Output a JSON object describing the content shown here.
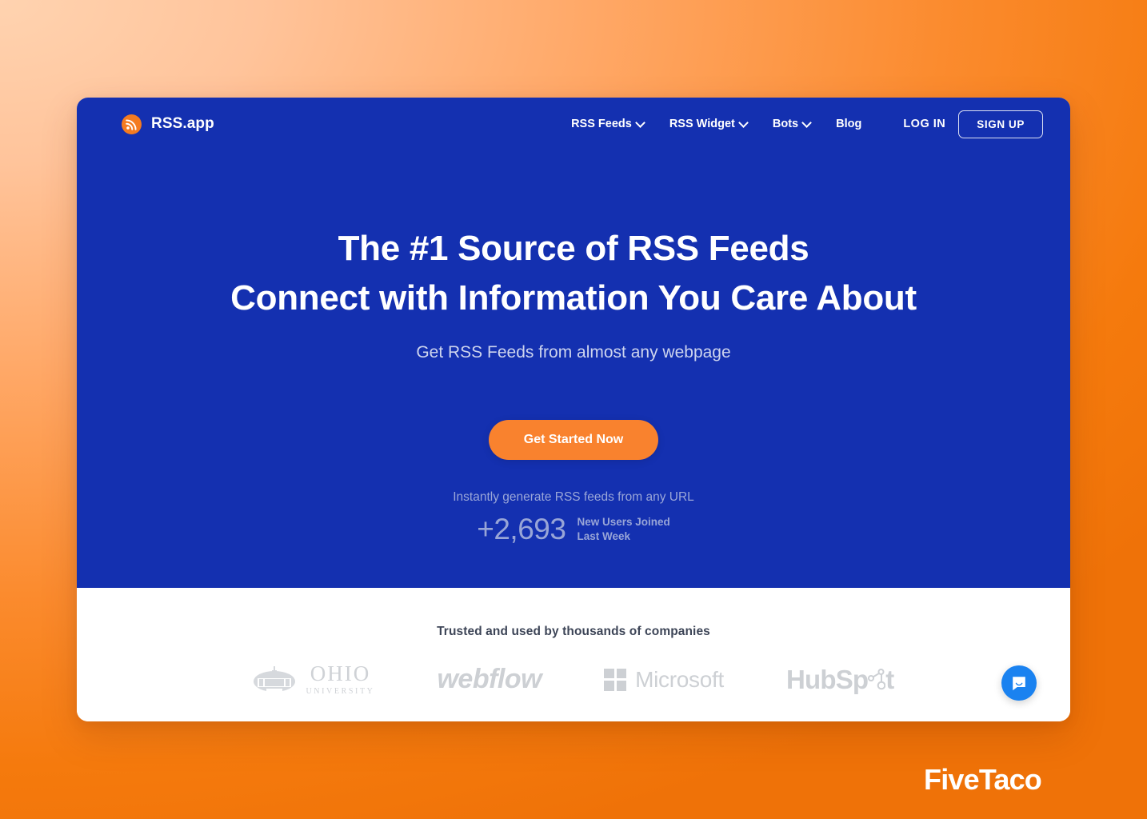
{
  "brand": {
    "name": "RSS.app",
    "logo_icon": "rss-icon",
    "logo_color": "#f47b20"
  },
  "nav": {
    "items": [
      {
        "label": "RSS Feeds",
        "has_dropdown": true
      },
      {
        "label": "RSS Widget",
        "has_dropdown": true
      },
      {
        "label": "Bots",
        "has_dropdown": true
      },
      {
        "label": "Blog",
        "has_dropdown": false
      }
    ],
    "login_label": "LOG IN",
    "signup_label": "SIGN UP"
  },
  "hero": {
    "headline_line1": "The #1 Source of RSS Feeds",
    "headline_line2": "Connect with Information You Care About",
    "subhead": "Get RSS Feeds from almost any webpage",
    "cta_label": "Get Started Now",
    "tagline": "Instantly generate RSS feeds from any URL",
    "stats_number": "+2,693",
    "stats_label_line1": "New Users Joined",
    "stats_label_line2": "Last Week",
    "background_color": "#1430b0",
    "cta_color": "#f9822e"
  },
  "trust": {
    "title": "Trusted and used by thousands of companies",
    "logos": [
      {
        "name": "Ohio University",
        "main": "OHIO",
        "sub": "UNIVERSITY"
      },
      {
        "name": "Webflow",
        "main": "webflow"
      },
      {
        "name": "Microsoft",
        "main": "Microsoft"
      },
      {
        "name": "HubSpot",
        "main": "HubSp",
        "tail": "t"
      }
    ]
  },
  "chat": {
    "icon": "chat-bubble-icon",
    "color": "#1a82f0"
  },
  "watermark": {
    "text": "FiveTaco"
  }
}
